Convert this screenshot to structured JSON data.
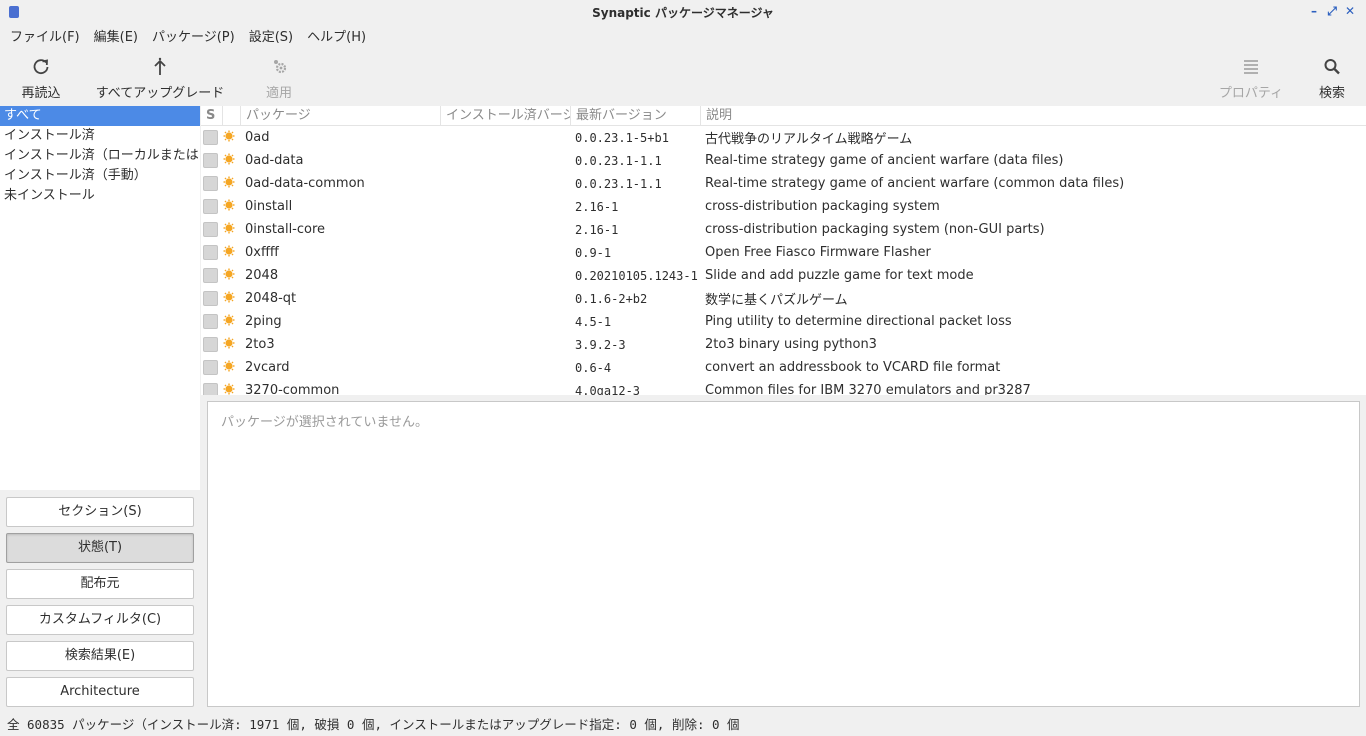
{
  "window": {
    "title": "Synaptic パッケージマネージャ"
  },
  "menu": [
    "ファイル(F)",
    "編集(E)",
    "パッケージ(P)",
    "設定(S)",
    "ヘルプ(H)"
  ],
  "toolbar": {
    "reload": "再読込",
    "upgrade_all": "すべてアップグレード",
    "apply": "適用",
    "properties": "プロパティ",
    "search": "検索"
  },
  "filters": [
    "すべて",
    "インストール済",
    "インストール済（ローカルまたは",
    "インストール済（手動）",
    "未インストール"
  ],
  "filter_buttons": [
    "セクション(S)",
    "状態(T)",
    "配布元",
    "カスタムフィルタ(C)",
    "検索結果(E)",
    "Architecture"
  ],
  "table": {
    "headers": {
      "s": "S",
      "package": "パッケージ",
      "installed": "インストール済バージ",
      "latest": "最新バージョン",
      "description": "説明"
    },
    "rows": [
      {
        "name": "0ad",
        "latest": "0.0.23.1-5+b1",
        "desc": "古代戦争のリアルタイム戦略ゲーム"
      },
      {
        "name": "0ad-data",
        "latest": "0.0.23.1-1.1",
        "desc": "Real-time strategy game of ancient warfare (data files)"
      },
      {
        "name": "0ad-data-common",
        "latest": "0.0.23.1-1.1",
        "desc": "Real-time strategy game of ancient warfare (common data files)"
      },
      {
        "name": "0install",
        "latest": "2.16-1",
        "desc": "cross-distribution packaging system"
      },
      {
        "name": "0install-core",
        "latest": "2.16-1",
        "desc": "cross-distribution packaging system (non-GUI parts)"
      },
      {
        "name": "0xffff",
        "latest": "0.9-1",
        "desc": "Open Free Fiasco Firmware Flasher"
      },
      {
        "name": "2048",
        "latest": "0.20210105.1243-1",
        "desc": "Slide and add puzzle game for text mode"
      },
      {
        "name": "2048-qt",
        "latest": "0.1.6-2+b2",
        "desc": "数学に基くパズルゲーム"
      },
      {
        "name": "2ping",
        "latest": "4.5-1",
        "desc": "Ping utility to determine directional packet loss"
      },
      {
        "name": "2to3",
        "latest": "3.9.2-3",
        "desc": "2to3 binary using python3"
      },
      {
        "name": "2vcard",
        "latest": "0.6-4",
        "desc": "convert an addressbook to VCARD file format"
      },
      {
        "name": "3270-common",
        "latest": "4.0ga12-3",
        "desc": "Common files for IBM 3270 emulators and pr3287"
      }
    ]
  },
  "details": {
    "placeholder": "パッケージが選択されていません。"
  },
  "status": "全 60835 パッケージ（インストール済: 1971 個, 破損 0 個, インストールまたはアップグレード指定: 0 個, 削除: 0 個"
}
